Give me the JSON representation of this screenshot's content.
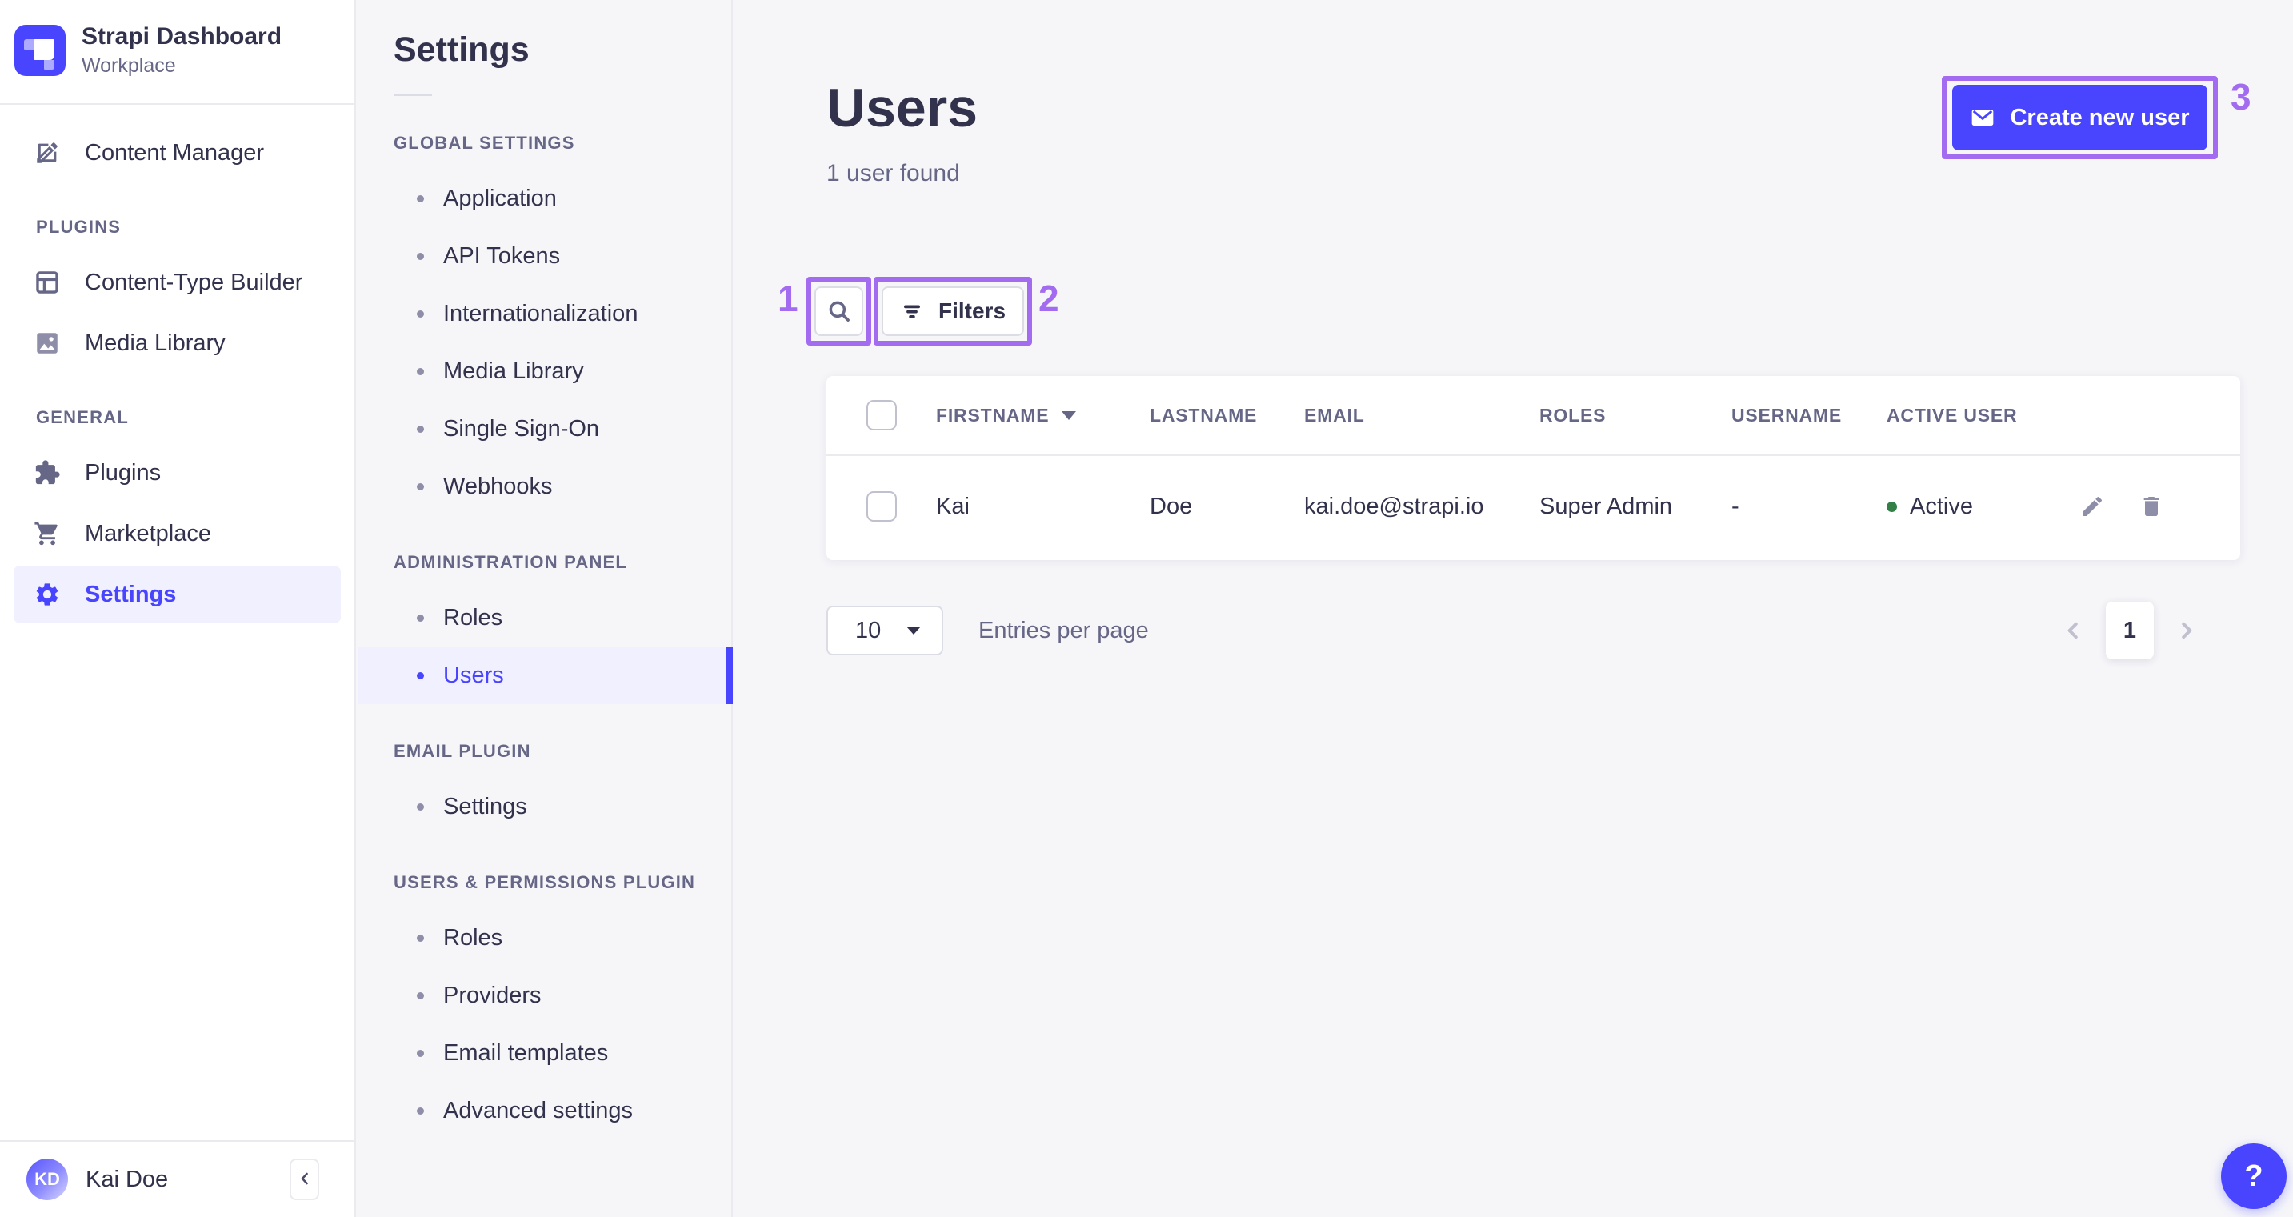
{
  "brand": {
    "title": "Strapi Dashboard",
    "subtitle": "Workplace"
  },
  "nav": {
    "content_manager": "Content Manager",
    "plugins_section": "PLUGINS",
    "content_type_builder": "Content-Type Builder",
    "media_library": "Media Library",
    "general_section": "GENERAL",
    "plugins": "Plugins",
    "marketplace": "Marketplace",
    "settings": "Settings"
  },
  "user_footer": {
    "initials": "KD",
    "name": "Kai Doe"
  },
  "subnav": {
    "title": "Settings",
    "global_section": "GLOBAL SETTINGS",
    "global_items": [
      "Application",
      "API Tokens",
      "Internationalization",
      "Media Library",
      "Single Sign-On",
      "Webhooks"
    ],
    "admin_section": "ADMINISTRATION PANEL",
    "admin_items": [
      "Roles",
      "Users"
    ],
    "email_section": "EMAIL PLUGIN",
    "email_items": [
      "Settings"
    ],
    "up_section": "USERS & PERMISSIONS PLUGIN",
    "up_items": [
      "Roles",
      "Providers",
      "Email templates",
      "Advanced settings"
    ]
  },
  "page": {
    "title": "Users",
    "subtitle": "1 user found",
    "create_button": "Create new user",
    "filters_button": "Filters"
  },
  "table": {
    "headers": {
      "firstname": "FIRSTNAME",
      "lastname": "LASTNAME",
      "email": "EMAIL",
      "roles": "ROLES",
      "username": "USERNAME",
      "active": "ACTIVE USER"
    },
    "row": {
      "firstname": "Kai",
      "lastname": "Doe",
      "email": "kai.doe@strapi.io",
      "roles": "Super Admin",
      "username": "-",
      "active": "Active"
    }
  },
  "pagination": {
    "page_size": "10",
    "entries_label": "Entries per page",
    "current_page": "1"
  },
  "annotations": {
    "a1": "1",
    "a2": "2",
    "a3": "3"
  },
  "help_label": "?",
  "colors": {
    "primary": "#4945FF",
    "active_bg": "#F0F0FF",
    "annotation": "#A36CF0",
    "success": "#328048"
  }
}
